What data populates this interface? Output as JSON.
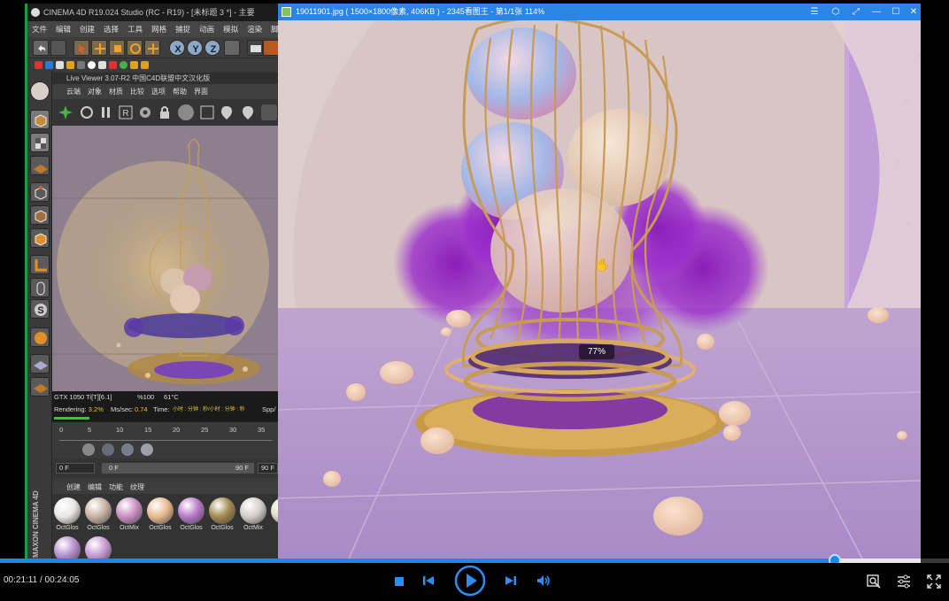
{
  "c4d": {
    "title": "CINEMA 4D R19.024 Studio (RC - R19) - [未标题 3 *] - 主要",
    "menu": [
      "文件",
      "编辑",
      "创建",
      "选择",
      "工具",
      "网格",
      "捕捉",
      "动画",
      "模拟",
      "渲染",
      "脚本"
    ],
    "live_viewer_title": "Live Viewer 3.07-R2 中国C4D联盟中文汉化版",
    "live_viewer_menu": [
      "云端",
      "对象",
      "材质",
      "比较",
      "选项",
      "帮助",
      "界面"
    ],
    "render_stats": {
      "gpu": "GTX 1050 Ti[T][6.1]",
      "percent": "%100",
      "temp": "61°C",
      "rendering_label": "Rendering:",
      "rendering_value": "3.2%",
      "ms_label": "Ms/sec:",
      "ms_value": "0.74",
      "time_label": "Time:",
      "time_value": "小时 : 分钟 : 秒/小时 : 分钟 : 秒",
      "spp_label": "Spp/",
      "progress": 0.032
    },
    "timeline": {
      "ticks": [
        "0",
        "5",
        "10",
        "15",
        "20",
        "25",
        "30",
        "35"
      ],
      "frame_start": "0 F",
      "range_start": "0 F",
      "range_end": "90 F",
      "frame_end": "90 F"
    },
    "material_menu": [
      "创建",
      "编辑",
      "功能",
      "纹理"
    ],
    "materials": [
      {
        "label": "OctGlos",
        "color": "#e9e6e4"
      },
      {
        "label": "OctGlos",
        "color": "#c9b2a5"
      },
      {
        "label": "OctMix",
        "color": "#c98fc2"
      },
      {
        "label": "OctGlos",
        "color": "#e8b98f"
      },
      {
        "label": "OctGlos",
        "color": "#b67ac9"
      },
      {
        "label": "OctGlos",
        "color": "#a28a52"
      },
      {
        "label": "OctMix",
        "color": "#d5cdc8"
      },
      {
        "label": "Oct",
        "color": "#e2d9c8"
      },
      {
        "label": "",
        "color": "#b88fd0"
      },
      {
        "label": "",
        "color": "#c99ad6"
      }
    ],
    "maxon_text": "MAXON CINEMA 4D"
  },
  "viewer": {
    "title": "19011901.jpg ( 1500×1800像素, 406KB ) - 2345看图王 - 第1/1张 114%",
    "zoom_overlay": "77%",
    "title_buttons": [
      "menu-icon",
      "skin-icon",
      "fullscreen-icon",
      "minimize-icon",
      "maximize-icon",
      "close-icon"
    ]
  },
  "player": {
    "current_time": "00:21:11",
    "total_time": "00:24:05",
    "time_separator": " / ",
    "progress": 0.8795
  },
  "colors": {
    "accent": "#1e88e5",
    "viewer_title": "#2a85e6",
    "c4d_green": "#1e9c3c"
  }
}
